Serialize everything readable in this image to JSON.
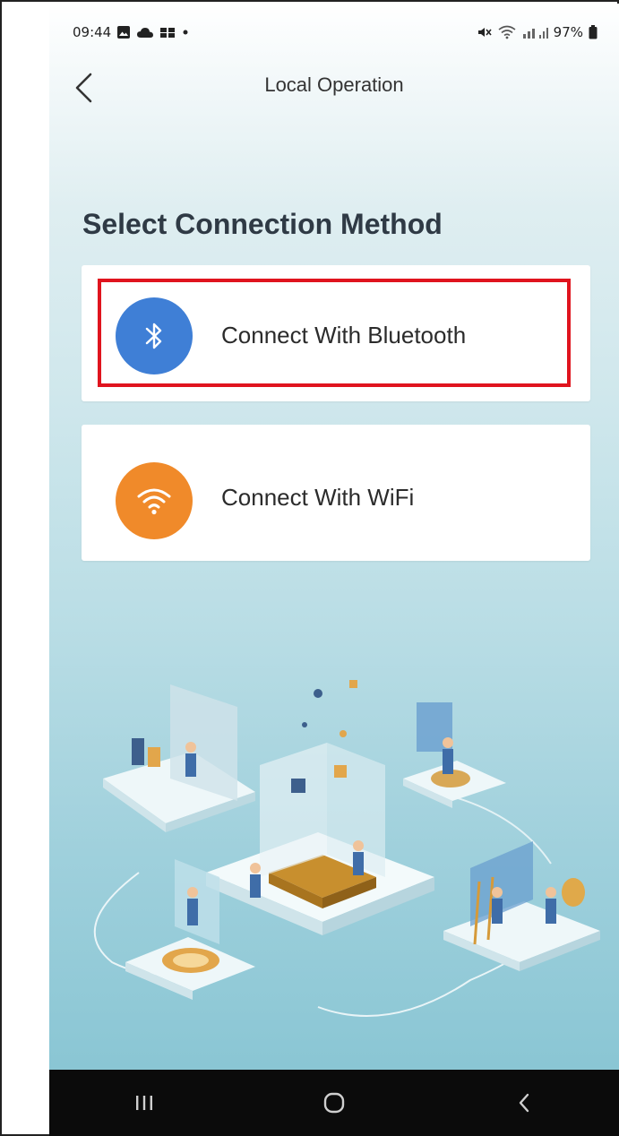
{
  "status_bar": {
    "time": "09:44",
    "battery": "97%",
    "left_icons": [
      "gallery-icon",
      "cloud-icon",
      "notification-icon",
      "dot-icon"
    ],
    "right_icons": [
      "mute-icon",
      "wifi-icon",
      "signal-icon",
      "battery-icon"
    ]
  },
  "header": {
    "title": "Local Operation",
    "back_icon": "chevron-left-icon"
  },
  "main": {
    "heading": "Select Connection Method",
    "options": [
      {
        "label": "Connect With Bluetooth",
        "icon": "bluetooth-icon",
        "icon_color": "#3f7fd6",
        "highlighted": true
      },
      {
        "label": "Connect With WiFi",
        "icon": "wifi-icon",
        "icon_color": "#f08a2a",
        "highlighted": false
      }
    ],
    "highlight_color": "#e0141e"
  },
  "system_nav": {
    "buttons": [
      "recents-icon",
      "home-icon",
      "back-icon"
    ]
  }
}
